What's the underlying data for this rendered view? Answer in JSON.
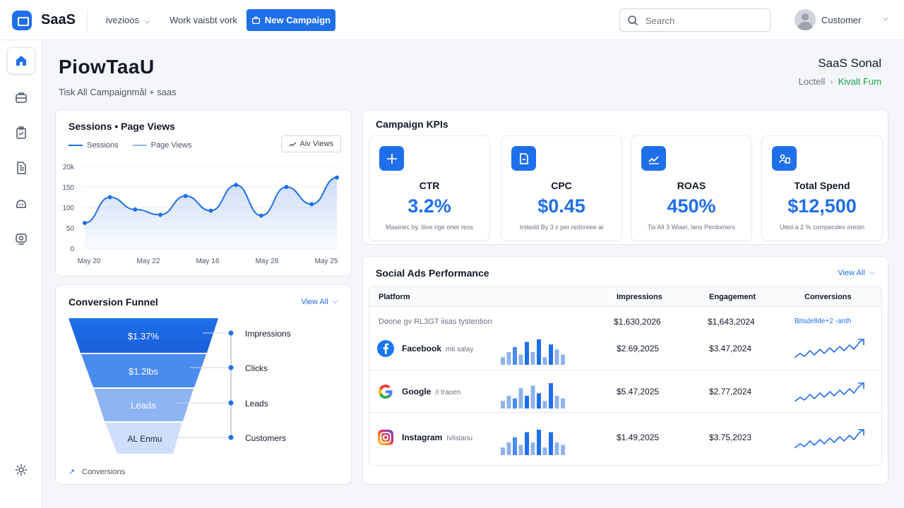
{
  "header": {
    "brand": "SaaS",
    "nav": [
      {
        "label": "ivezioos"
      },
      {
        "label": "Work vaisbt vork"
      }
    ],
    "new_campaign_label": "New Campaign",
    "search_placeholder": "Search",
    "user_name": "Customer"
  },
  "sidebar": {
    "items": [
      {
        "name": "home-icon",
        "active": true
      },
      {
        "name": "briefcase-icon",
        "active": false
      },
      {
        "name": "clipboard-icon",
        "active": false
      },
      {
        "name": "document-icon",
        "active": false
      },
      {
        "name": "support-icon",
        "active": false
      },
      {
        "name": "camera-icon",
        "active": false
      },
      {
        "name": "gear-icon",
        "active": false
      }
    ]
  },
  "page": {
    "title": "PiowTaaU",
    "subtitle": "Tisk All Campaignmål + saas",
    "org": "SaaS Sonal",
    "breadcrumb": [
      "Loctell",
      "Kivalt Fum"
    ]
  },
  "sessions": {
    "title": "Sessions • Page Views",
    "legend": [
      "Sessions",
      "Page Views"
    ],
    "button_label": "Aiv Views",
    "colors": {
      "primary": "#1f6feb",
      "secondary": "#8fb3ef"
    }
  },
  "chart_data": {
    "type": "line",
    "title": "Sessions • Page Views",
    "x": [
      "May 20",
      "May 22",
      "May 16",
      "May 28",
      "May 25"
    ],
    "y_ticks": [
      "0",
      "50",
      "100",
      "150",
      "20k"
    ],
    "ylim": [
      0,
      200
    ],
    "grid": true,
    "legend": "top-left",
    "series": [
      {
        "name": "Sessions",
        "values": [
          62,
          125,
          95,
          82,
          128,
          92,
          155,
          80,
          150,
          108,
          173
        ]
      }
    ]
  },
  "funnel": {
    "title": "Conversion Funnel",
    "view_all": "View All",
    "stages": [
      {
        "value": "$1.37%",
        "label": "Impressions"
      },
      {
        "value": "$1.2lbs",
        "label": "Clicks"
      },
      {
        "value": "Leads",
        "label": "Leads"
      },
      {
        "value": "AL Enmu",
        "label": "Customers"
      }
    ],
    "footer": "Conversions"
  },
  "kpis": {
    "title": "Campaign KPIs",
    "items": [
      {
        "label": "CTR",
        "value": "3.2%",
        "note": "Maainec by. Ilive rige oner ress",
        "icon": "crosshair-icon"
      },
      {
        "label": "CPC",
        "value": "$0.45",
        "note": "Irstedd By 3 z per redoreee ai",
        "icon": "file-icon"
      },
      {
        "label": "ROAS",
        "value": "450%",
        "note": "Tis All 3 Wlael, lans Perdomers",
        "icon": "trend-icon"
      },
      {
        "label": "Total Spend",
        "value": "$12,500",
        "note": "Uted a 2 % compecdev oresin",
        "icon": "team-icon"
      }
    ]
  },
  "social": {
    "title": "Social Ads Performance",
    "view_all": "View All",
    "columns": [
      "Platform",
      "Impressions",
      "Engagement",
      "Conversions"
    ],
    "summary": {
      "label": "Doone gv RL3GT iisas tystention",
      "impressions": "$1,630,2026",
      "engagement": "$1,643,2024",
      "conversions": "Bitsdellde+2 -anth"
    },
    "rows": [
      {
        "platform": "Facebook",
        "sub": "mti salay",
        "impressions": "$2.69,2025",
        "engagement": "$3.47,2024",
        "icon": "facebook-icon",
        "bars": [
          3,
          5,
          7,
          4,
          9,
          5,
          10,
          3,
          8,
          6,
          4
        ]
      },
      {
        "platform": "Google",
        "sub": "/i traoen",
        "impressions": "$5.47,2025",
        "engagement": "$2.77,2024",
        "icon": "google-icon",
        "bars": [
          3,
          5,
          4,
          8,
          5,
          9,
          6,
          3,
          10,
          5,
          4
        ]
      },
      {
        "platform": "Instagram",
        "sub": "Ivlistanu",
        "impressions": "$1.49,2025",
        "engagement": "$3.75,2023",
        "icon": "instagram-icon",
        "bars": [
          3,
          5,
          7,
          4,
          9,
          5,
          10,
          3,
          9,
          5,
          4
        ]
      }
    ]
  }
}
